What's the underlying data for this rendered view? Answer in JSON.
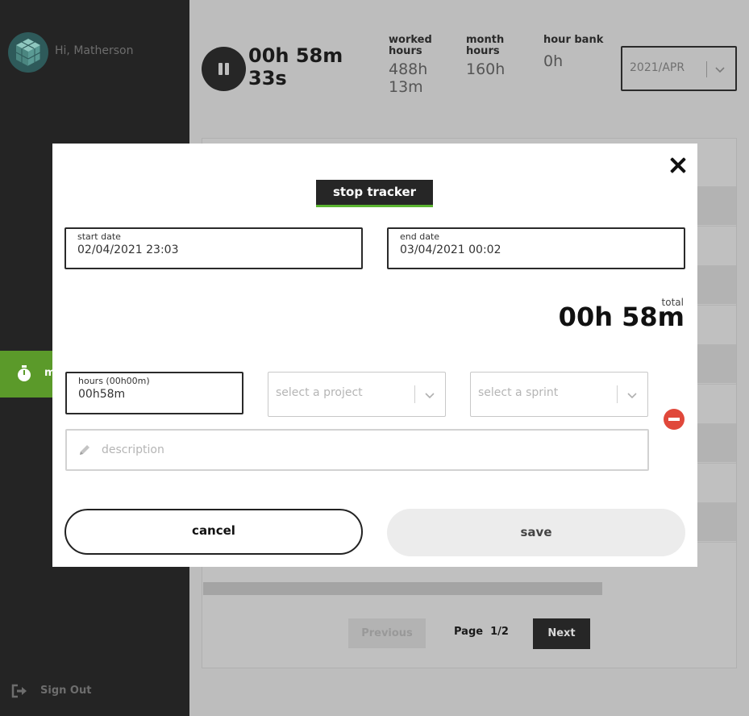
{
  "sidebar": {
    "greeting": "Hi, Matherson",
    "active_item": "m",
    "sign_out": "Sign Out"
  },
  "header": {
    "timer": "00h 58m 33s",
    "stats": [
      {
        "label": "worked hours",
        "value": "488h 13m"
      },
      {
        "label": "month hours",
        "value": "160h"
      },
      {
        "label": "hour bank",
        "value": "0h"
      }
    ],
    "month_select": "2021/APR"
  },
  "pagination": {
    "previous": "Previous",
    "page_label": "Page",
    "page_value": "1/2",
    "next": "Next"
  },
  "modal": {
    "title": "stop tracker",
    "start_date": {
      "label": "start date",
      "value": "02/04/2021 23:03"
    },
    "end_date": {
      "label": "end date",
      "value": "03/04/2021 00:02"
    },
    "total_label": "total",
    "total_value": "00h 58m",
    "hours": {
      "label": "hours (00h00m)",
      "value": "00h58m"
    },
    "project_placeholder": "select a project",
    "sprint_placeholder": "select a sprint",
    "description_placeholder": "description",
    "cancel": "cancel",
    "save": "save"
  },
  "colors": {
    "accent_green": "#5b9a2a",
    "remove_red": "#e0483b",
    "dark": "#262626"
  }
}
